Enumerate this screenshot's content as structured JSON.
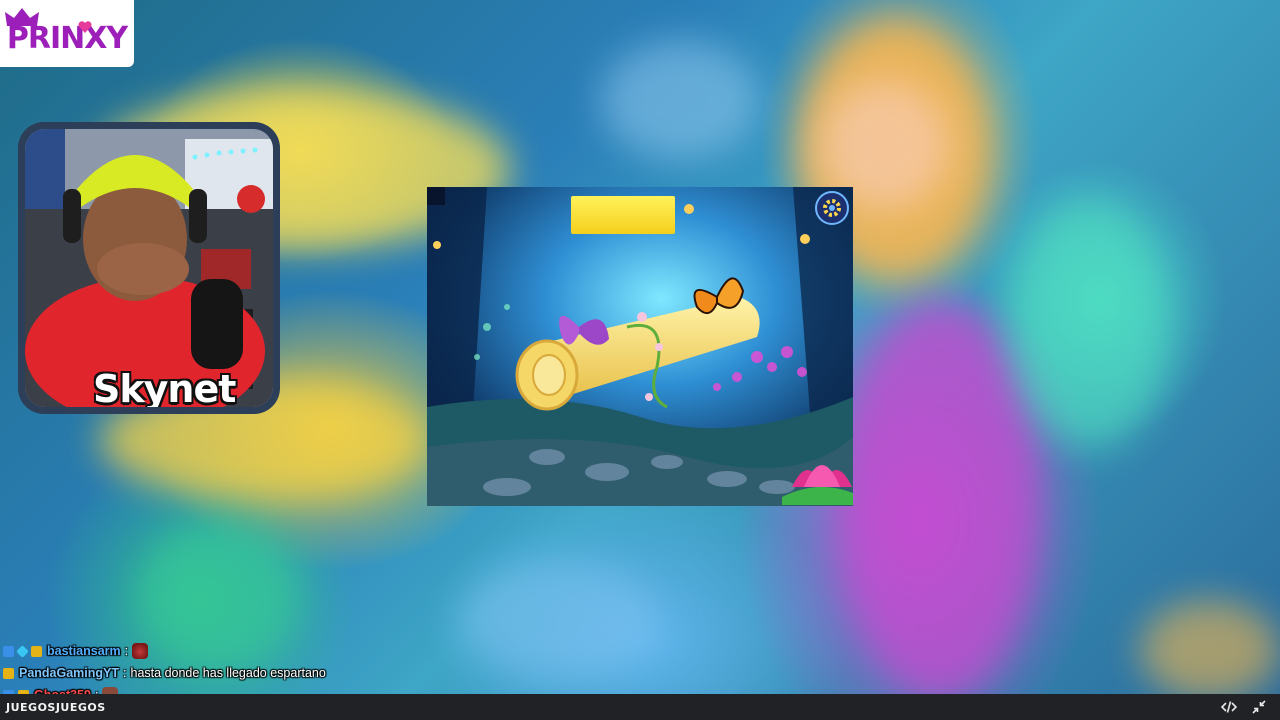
{
  "logo": {
    "text": "PRINXY"
  },
  "webcam": {
    "name": "Skynet"
  },
  "chat": {
    "messages": [
      {
        "user": "bastiansarm",
        "separator": ":",
        "text": "",
        "badges": [
          "blue",
          "cyan",
          "gold"
        ],
        "user_color": "#54b0ff",
        "emote": "devil-emote"
      },
      {
        "user": "PandaGamingYT",
        "separator": ":",
        "text": "hasta donde has llegado espartano",
        "badges": [
          "gold"
        ],
        "user_color": "#7ec7ff",
        "emote": ""
      },
      {
        "user": "Ghost359",
        "separator": ":",
        "text": "",
        "badges": [
          "blue",
          "gold"
        ],
        "user_color": "#ff4b4b",
        "emote": "avatar-emote"
      }
    ]
  },
  "bottombar": {
    "brand": "JUEGOSJUEGOS",
    "icons": [
      "code-icon",
      "collapse-icon"
    ]
  },
  "colors": {
    "logo_purple": "#9b1fb8",
    "bar_bg": "#202226",
    "brand_accent": "#f2b81a"
  }
}
